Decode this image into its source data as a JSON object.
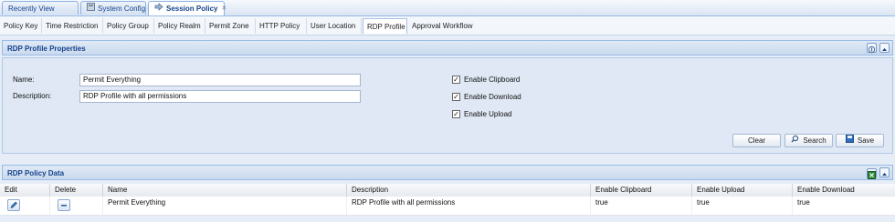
{
  "top_tabs": [
    {
      "label": "Recently View",
      "active": false,
      "closable": false
    },
    {
      "label": "System Config Man.",
      "active": false,
      "closable": true
    },
    {
      "label": "Session Policy",
      "active": true,
      "closable": true
    }
  ],
  "sub_tabs": [
    {
      "label": "Policy Key"
    },
    {
      "label": "Time Restriction"
    },
    {
      "label": "Policy Group"
    },
    {
      "label": "Policy Realm"
    },
    {
      "label": "Permit Zone"
    },
    {
      "label": "HTTP Policy"
    },
    {
      "label": "User Location"
    },
    {
      "label": "RDP Profile",
      "active": true
    },
    {
      "label": "Approval Workflow"
    }
  ],
  "props_panel": {
    "title": "RDP Profile Properties",
    "name_label": "Name:",
    "name_value": "Permit Everything",
    "desc_label": "Description:",
    "desc_value": "RDP Profile with all permissions",
    "checkboxes": [
      {
        "label": "Enable Clipboard",
        "checked": true
      },
      {
        "label": "Enable Download",
        "checked": true
      },
      {
        "label": "Enable Upload",
        "checked": true
      }
    ],
    "buttons": {
      "clear": "Clear",
      "search": "Search",
      "save": "Save"
    }
  },
  "data_panel": {
    "title": "RDP Policy Data",
    "columns": [
      "Edit",
      "Delete",
      "Name",
      "Description",
      "Enable Clipboard",
      "Enable Upload",
      "Enable Download"
    ],
    "rows": [
      {
        "name": "Permit Everything",
        "description": "RDP Profile with all permissions",
        "clipboard": "true",
        "upload": "true",
        "download": "true"
      }
    ]
  },
  "colors": {
    "accent": "#15428b",
    "header_border": "#99bbe8"
  }
}
